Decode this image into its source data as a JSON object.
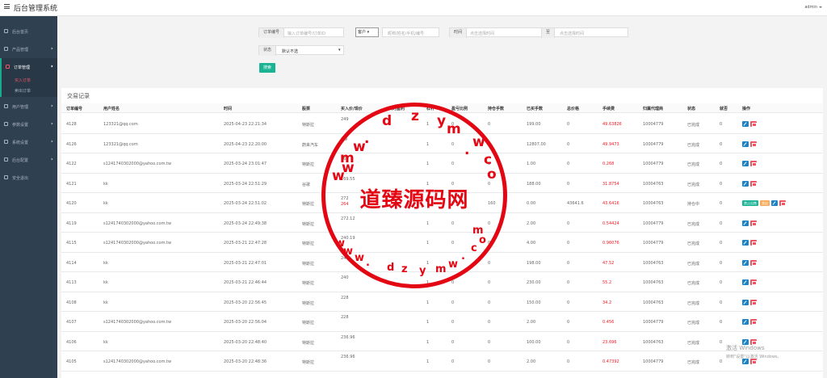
{
  "header": {
    "title": "后台管理系统",
    "user": "admin"
  },
  "sidebar": {
    "items": [
      {
        "label": "后台首页",
        "icon": "home-icon"
      },
      {
        "label": "产品管理",
        "icon": "dollar-icon"
      },
      {
        "label": "订单管理",
        "icon": "list-icon"
      },
      {
        "label": "用户管理",
        "icon": "user-icon"
      },
      {
        "label": "参数设置",
        "icon": "file-icon"
      },
      {
        "label": "系统设置",
        "icon": "gears-icon"
      },
      {
        "label": "后台配置",
        "icon": "gear-icon"
      },
      {
        "label": "安全退出",
        "icon": "exit-icon"
      }
    ],
    "sub_items": [
      "买入订单",
      "卖出订单"
    ]
  },
  "filters": {
    "order_label": "订单编号",
    "order_placeholder": "输入订单编号/订单ID",
    "client_select": "客户",
    "client_placeholder": "昵称/姓名/手机/编号",
    "time_label": "时间",
    "time_start_placeholder": "点击选择时间",
    "time_sep": "至",
    "time_end_placeholder": "点击选择时间",
    "status_label": "状态",
    "status_value": "默认不选",
    "search_label": "搜索"
  },
  "panel": {
    "title": "交易记录",
    "columns": [
      "订单编号",
      "用户姓名",
      "时间",
      "股票",
      "买入价/现价",
      "买时盈利",
      "杠杆",
      "盈亏比例",
      "持仓手数",
      "已买手数",
      "总价格",
      "手续费",
      "归属代理商",
      "状态",
      "就否",
      "操作"
    ],
    "rows": [
      {
        "id": "4128",
        "user": "123321@qq.com",
        "time": "2025-04-23 22:21:34",
        "stock": "特斯拉",
        "price": "249",
        "lev": "1",
        "ratio": "0",
        "hold": "0",
        "bought": "199.00",
        "total": "0",
        "fee": "49.63826",
        "agent": "10004779",
        "status": "已完成",
        "flag": "0"
      },
      {
        "id": "4126",
        "user": "123321@qq.com",
        "time": "2025-04-23 22:20:00",
        "stock": "蔚来汽车",
        "price": "3.9",
        "lev": "1",
        "ratio": "0",
        "hold": "0",
        "bought": "12807.00",
        "total": "0",
        "fee": "49.9473",
        "agent": "10004779",
        "status": "已完成",
        "flag": "0"
      },
      {
        "id": "4122",
        "user": "s1241740302000@yahoo.com.tw",
        "time": "2025-03-24 23:01:47",
        "stock": "特斯拉",
        "price": "268",
        "lev": "1",
        "ratio": "0",
        "hold": "0",
        "bought": "1.00",
        "total": "0",
        "fee": "0.268",
        "agent": "10004779",
        "status": "已完成",
        "flag": "0"
      },
      {
        "id": "4121",
        "user": "kk",
        "time": "2025-03-24 22:51:29",
        "stock": "谷歌",
        "price": "169.55",
        "lev": "1",
        "ratio": "0",
        "hold": "0",
        "bought": "188.00",
        "total": "0",
        "fee": "31.8754",
        "agent": "10004763",
        "status": "已完成",
        "flag": "0"
      },
      {
        "id": "4120",
        "user": "kk",
        "time": "2025-03-24 22:51:02",
        "stock": "特斯拉",
        "price": "272",
        "price2": "264",
        "lev": "1",
        "ratio": "0",
        "hold": "160",
        "bought": "0.00",
        "total": "43641.6",
        "fee": "43.6416",
        "agent": "10004763",
        "status": "持仓中",
        "flag": "0",
        "special": true
      },
      {
        "id": "4119",
        "user": "s1241740302000@yahoo.com.tw",
        "time": "2025-03-24 22:49:38",
        "stock": "特斯拉",
        "price": "272.12",
        "lev": "1",
        "ratio": "0",
        "hold": "0",
        "bought": "2.00",
        "total": "0",
        "fee": "0.54424",
        "agent": "10004779",
        "status": "已完成",
        "flag": "0"
      },
      {
        "id": "4115",
        "user": "s1241740302000@yahoo.com.tw",
        "time": "2025-03-21 22:47:28",
        "stock": "特斯拉",
        "price": "240.19",
        "lev": "1",
        "ratio": "0",
        "hold": "0",
        "bought": "4.00",
        "total": "0",
        "fee": "0.96076",
        "agent": "10004779",
        "status": "已完成",
        "flag": "0"
      },
      {
        "id": "4114",
        "user": "kk",
        "time": "2025-03-21 22:47:01",
        "stock": "特斯拉",
        "price": "240",
        "lev": "1",
        "ratio": "0",
        "hold": "0",
        "bought": "198.00",
        "total": "0",
        "fee": "47.52",
        "agent": "10004763",
        "status": "已完成",
        "flag": "0"
      },
      {
        "id": "4113",
        "user": "kk",
        "time": "2025-03-21 22:46:44",
        "stock": "特斯拉",
        "price": "240",
        "lev": "1",
        "ratio": "0",
        "hold": "0",
        "bought": "230.00",
        "total": "0",
        "fee": "55.2",
        "agent": "10004763",
        "status": "已完成",
        "flag": "0"
      },
      {
        "id": "4108",
        "user": "kk",
        "time": "2025-03-20 22:56:45",
        "stock": "特斯拉",
        "price": "228",
        "lev": "1",
        "ratio": "0",
        "hold": "0",
        "bought": "150.00",
        "total": "0",
        "fee": "34.2",
        "agent": "10004763",
        "status": "已完成",
        "flag": "0"
      },
      {
        "id": "4107",
        "user": "s1241740302000@yahoo.com.tw",
        "time": "2025-03-20 22:56:04",
        "stock": "特斯拉",
        "price": "228",
        "lev": "1",
        "ratio": "0",
        "hold": "0",
        "bought": "2.00",
        "total": "0",
        "fee": "0.456",
        "agent": "10004779",
        "status": "已完成",
        "flag": "0"
      },
      {
        "id": "4106",
        "user": "kk",
        "time": "2025-03-20 22:48:40",
        "stock": "特斯拉",
        "price": "236.96",
        "lev": "1",
        "ratio": "0",
        "hold": "0",
        "bought": "100.00",
        "total": "0",
        "fee": "23.696",
        "agent": "10004763",
        "status": "已完成",
        "flag": "0"
      },
      {
        "id": "4105",
        "user": "s1241740302000@yahoo.com.tw",
        "time": "2025-03-20 22:48:36",
        "stock": "特斯拉",
        "price": "236.96",
        "lev": "1",
        "ratio": "0",
        "hold": "0",
        "bought": "2.00",
        "total": "0",
        "fee": "0.47392",
        "agent": "10004779",
        "status": "已完成",
        "flag": "0"
      }
    ],
    "special_ops": [
      "禁止出售",
      "卖出"
    ]
  },
  "watermark": {
    "center_text": "道臻源码网",
    "top_letters": [
      "d",
      "z",
      "y",
      "m",
      "w",
      ".",
      "c",
      "o",
      "m",
      "w",
      "w",
      "w",
      "."
    ],
    "bottom_letters": [
      "w",
      "w",
      "w",
      ".",
      "d",
      "z",
      "y",
      "m",
      "w",
      ".",
      "c",
      "o",
      "m"
    ]
  },
  "windows_notice": {
    "line1": "激活 Windows",
    "line2": "转到\"设置\"以激活 Windows。"
  },
  "colors": {
    "sidebar": "#2f4050",
    "accent": "#1ab394",
    "danger": "#ed5565",
    "edit": "#1c84c6",
    "warn": "#f8ac59"
  }
}
